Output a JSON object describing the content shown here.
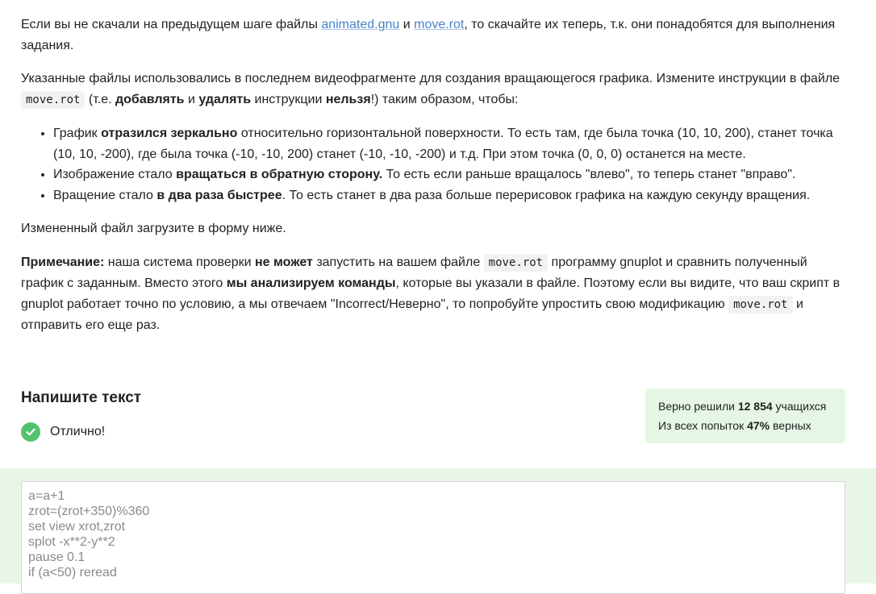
{
  "task": {
    "p1": {
      "before": "Если вы не скачали на предыдущем шаге файлы ",
      "link1": "animated.gnu",
      "and": " и ",
      "link2": "move.rot",
      "after": ", то скачайте их теперь, т.к. они понадобятся для выполнения задания."
    },
    "p2": {
      "text1": "Указанные файлы использовались в последнем видеофрагменте для создания вращающегося графика. Измените инструкции в файле ",
      "code": "move.rot",
      "text2": " (т.е. ",
      "bold1": "добавлять",
      "text3": " и ",
      "bold2": "удалять",
      "text4": " инструкции ",
      "bold3": "нельзя",
      "text5": "!) таким образом, чтобы:"
    },
    "bullets": [
      {
        "pre": "График ",
        "bold": "отразился зеркально",
        "post": " относительно горизонтальной поверхности. То есть там, где была точка (10, 10, 200), станет точка (10, 10, -200), где была точка  (-10, -10, 200) станет (-10, -10, -200) и т.д. При этом точка (0, 0, 0) останется на месте."
      },
      {
        "pre": "Изображение стало ",
        "bold": "вращаться в обратную сторону.",
        "post": " То есть если раньше вращалось \"влево\", то теперь станет \"вправо\"."
      },
      {
        "pre": "Вращение стало ",
        "bold": "в два раза быстрее",
        "post": ". То есть станет в два раза больше перерисовок графика на каждую секунду вращения."
      }
    ],
    "p3": "Измененный файл загрузите в форму ниже.",
    "note": {
      "label": "Примечание:",
      "t1": " наша система проверки ",
      "b1": "не может",
      "t2": " запустить на вашем файле ",
      "code1": "move.rot",
      "t3": " программу gnuplot и сравнить полученный график с заданным. Вместо этого ",
      "b2": "мы анализируем команды",
      "t4": ", которые вы указали в файле. Поэтому если вы видите, что ваш скрипт в gnuplot работает точно по условию, а мы отвечаем \"Incorrect/Неверно\", то попробуйте упростить свою модификацию ",
      "code2": "move.rot",
      "t5": " и отправить его еще раз."
    }
  },
  "answer_section": {
    "heading": "Напишите текст",
    "status_text": "Отлично!",
    "status_icon": "check-circle-icon",
    "status_color": "#54c26d"
  },
  "stats": {
    "line1_prefix": "Верно решили ",
    "solved_count": "12 854",
    "line1_suffix": " учащихся",
    "line2_prefix": "Из всех попыток ",
    "percent": "47%",
    "line2_suffix": " верных"
  },
  "answer_code": {
    "lines": [
      "a=a+1",
      "zrot=(zrot+350)%360",
      "set view xrot,zrot",
      "splot -x**2-y**2",
      "pause 0.1",
      "if (a<50) reread"
    ]
  },
  "colors": {
    "link": "#4a84c9",
    "success_bg": "#e8f6e8",
    "stats_bg": "#e5f6e5"
  }
}
